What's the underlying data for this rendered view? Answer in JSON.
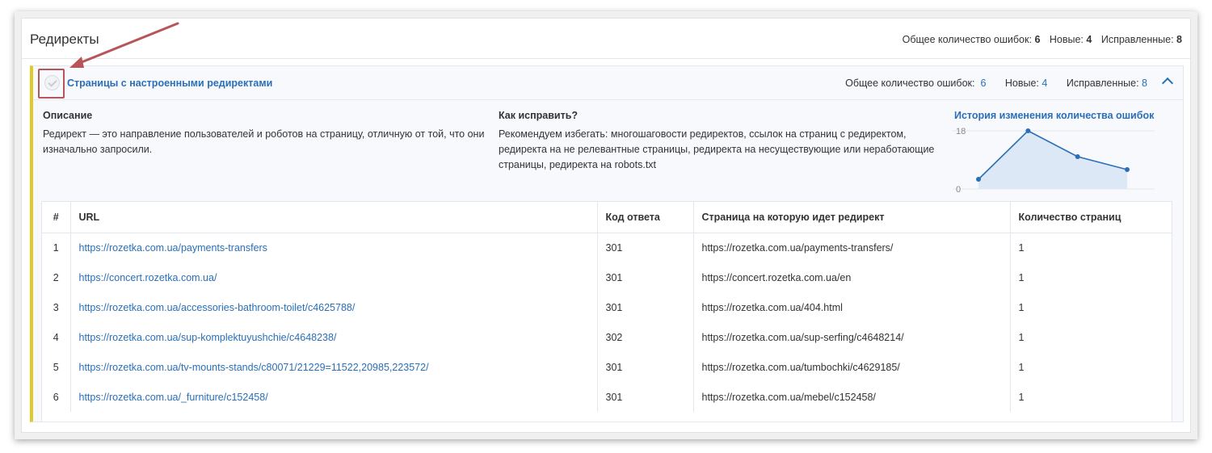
{
  "header": {
    "title": "Редиректы",
    "stats": [
      {
        "label": "Общее количество ошибок:",
        "value": "6"
      },
      {
        "label": "Новые:",
        "value": "4"
      },
      {
        "label": "Исправленные:",
        "value": "8"
      }
    ]
  },
  "section": {
    "title": "Страницы с настроенными редиректами",
    "stats": [
      {
        "label": "Общее количество ошибок:",
        "value": "6"
      },
      {
        "label": "Новые:",
        "value": "4"
      },
      {
        "label": "Исправленные:",
        "value": "8"
      }
    ],
    "description": {
      "heading": "Описание",
      "text": "Редирект — это направление пользователей и роботов на страницу, отличную от той, что они изначально запросили."
    },
    "fix": {
      "heading": "Как исправить?",
      "text": "Рекомендуем избегать: многошаговости редиректов, ссылок на страниц с редиректом, редиректа на не релевантные страницы, редиректа на несуществующие или неработающие страницы, редиректа на robots.txt"
    },
    "history_title": "История изменения количества ошибок"
  },
  "chart_data": {
    "type": "area",
    "x": [
      1,
      2,
      3,
      4
    ],
    "values": [
      3,
      18,
      10,
      6
    ],
    "ylim": [
      0,
      18
    ],
    "yticks": [
      "0",
      "18"
    ],
    "grid": true,
    "color": "#2a6fb8",
    "fill": "#dce8f5"
  },
  "table": {
    "columns": [
      "#",
      "URL",
      "Код ответа",
      "Страница на которую идет редирект",
      "Количество страниц"
    ],
    "rows": [
      {
        "n": "1",
        "url": "https://rozetka.com.ua/payments-transfers",
        "code": "301",
        "target": "https://rozetka.com.ua/payments-transfers/",
        "count": "1"
      },
      {
        "n": "2",
        "url": "https://concert.rozetka.com.ua/",
        "code": "301",
        "target": "https://concert.rozetka.com.ua/en",
        "count": "1"
      },
      {
        "n": "3",
        "url": "https://rozetka.com.ua/accessories-bathroom-toilet/c4625788/",
        "code": "301",
        "target": "https://rozetka.com.ua/404.html",
        "count": "1"
      },
      {
        "n": "4",
        "url": "https://rozetka.com.ua/sup-komplektuyushchie/c4648238/",
        "code": "302",
        "target": "https://rozetka.com.ua/sup-serfing/c4648214/",
        "count": "1"
      },
      {
        "n": "5",
        "url": "https://rozetka.com.ua/tv-mounts-stands/c80071/21229=11522,20985,223572/",
        "code": "301",
        "target": "https://rozetka.com.ua/tumbochki/c4629185/",
        "count": "1"
      },
      {
        "n": "6",
        "url": "https://rozetka.com.ua/_furniture/c152458/",
        "code": "301",
        "target": "https://rozetka.com.ua/mebel/c152458/",
        "count": "1"
      }
    ]
  }
}
